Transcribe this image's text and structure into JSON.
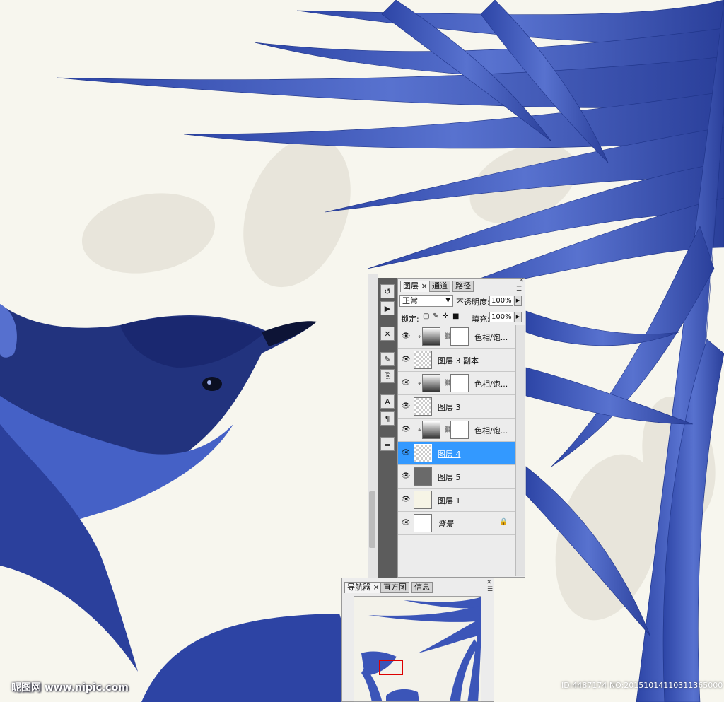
{
  "layers_panel": {
    "tabs": [
      {
        "label": "图层",
        "active": true
      },
      {
        "label": "通道",
        "active": false
      },
      {
        "label": "路径",
        "active": false
      }
    ],
    "blend_mode": "正常",
    "opacity_label": "不透明度:",
    "opacity_value": "100%",
    "lock_label": "锁定:",
    "fill_label": "填充:",
    "fill_value": "100%",
    "layers": [
      {
        "name": "色相/饱...",
        "kind": "adjustment",
        "selected": false
      },
      {
        "name": "图层 3 副本",
        "kind": "pixel",
        "selected": false
      },
      {
        "name": "色相/饱...",
        "kind": "adjustment",
        "selected": false
      },
      {
        "name": "图层 3",
        "kind": "pixel",
        "selected": false
      },
      {
        "name": "色相/饱...",
        "kind": "adjustment",
        "selected": false
      },
      {
        "name": "图层 4",
        "kind": "pixel",
        "selected": true
      },
      {
        "name": "图层 5",
        "kind": "pixel",
        "selected": false
      },
      {
        "name": "图层 1",
        "kind": "pixel",
        "selected": false
      },
      {
        "name": "背景",
        "kind": "background",
        "selected": false
      }
    ]
  },
  "navigator_panel": {
    "tabs": [
      {
        "label": "导航器",
        "active": true
      },
      {
        "label": "直方图",
        "active": false
      },
      {
        "label": "信息",
        "active": false
      }
    ]
  },
  "watermark": {
    "left": "昵图网 www.nipic.com",
    "right": "ID:4487174 NO:20151014110311365000"
  },
  "colors": {
    "accent_selected": "#3399ff",
    "artwork_blue": "#3b55b8",
    "background_cream": "#f7f6ee"
  }
}
